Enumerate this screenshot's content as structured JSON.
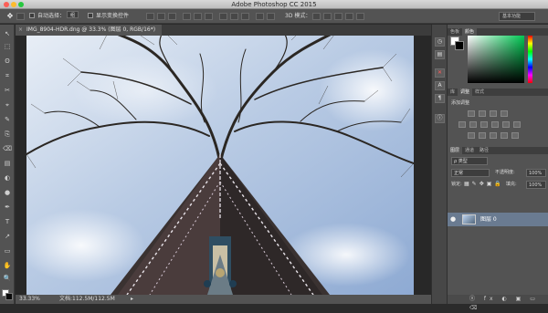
{
  "app": {
    "title": "Adobe Photoshop CC 2015"
  },
  "options": {
    "auto_select_label": "自动选择：",
    "auto_select_value": "组",
    "show_transform_label": "显示变换控件",
    "mode_3d": "3D 模式：",
    "workspace": "基本功能"
  },
  "document": {
    "tab_label": "IMG_8904-HDR.dng @ 33.3% (图层 0, RGB/16*)",
    "close_glyph": "×"
  },
  "status": {
    "zoom": "33.33%",
    "doc_info": "文档:112.5M/112.5M",
    "arrow": "▸"
  },
  "panels": {
    "color_tabs": [
      "色板",
      "颜色"
    ],
    "adjust_tabs": [
      "库",
      "调整",
      "样式"
    ],
    "adjust_title": "添加调整",
    "layers_tabs": [
      "图层",
      "通道",
      "路径"
    ],
    "kind_label": "ρ 类型",
    "blend_mode": "正常",
    "opacity_label": "不透明度:",
    "opacity_value": "100%",
    "lock_label": "锁定:",
    "fill_label": "填充:",
    "fill_value": "100%",
    "layer_name": "图层 0",
    "eye_glyph": "●",
    "footer_icons": "ⓞ fx ◐ ▣ ▭ ⌫"
  },
  "tools": [
    "↖",
    "⬚",
    "ʘ",
    "⌗",
    "✂",
    "⌖",
    "✎",
    "⎘",
    "⌫",
    "▤",
    "◐",
    "●",
    "✒",
    "T",
    "↗",
    "▭",
    "✋",
    "🔍"
  ],
  "colors": {
    "accent_layer": "#6a7b91",
    "sky": "#b9cbe4"
  }
}
